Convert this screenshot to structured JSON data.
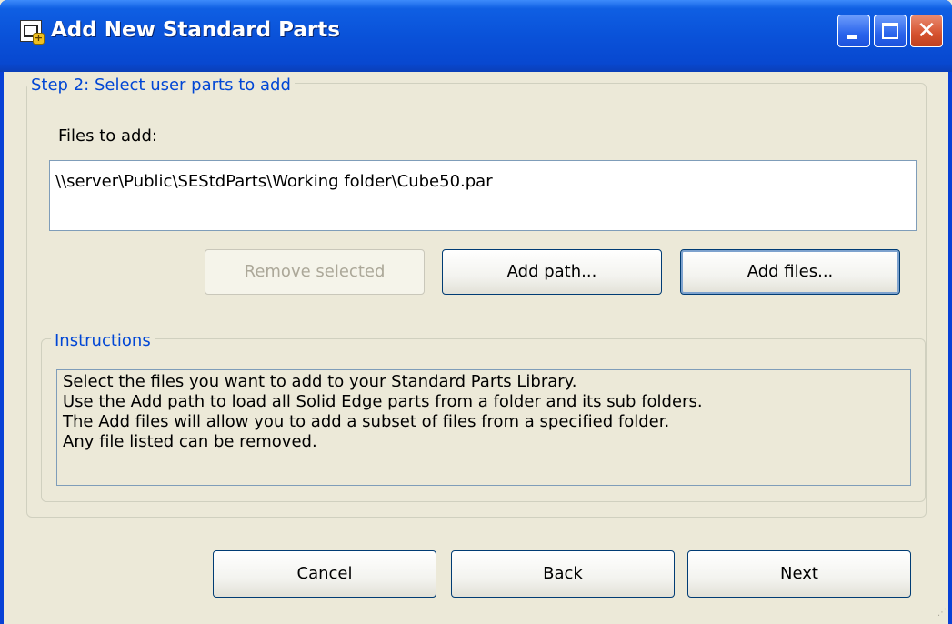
{
  "window": {
    "title": "Add New Standard Parts",
    "icons": {
      "app": "add-part-app-icon",
      "minimize": "minimize-icon",
      "maximize": "maximize-icon",
      "close": "close-icon"
    },
    "close_glyph": "✕"
  },
  "step": {
    "legend": "Step 2: Select user parts to add",
    "files_label": "Files to add:",
    "files": [
      "\\\\server\\Public\\SEStdParts\\Working folder\\Cube50.par"
    ],
    "buttons": {
      "remove": "Remove selected",
      "add_path": "Add path...",
      "add_files": "Add files..."
    }
  },
  "instructions": {
    "legend": "Instructions",
    "lines": [
      "Select the files you want to add to your Standard Parts Library.",
      "Use the Add path to load all Solid Edge parts from a folder and its sub folders.",
      "The Add files will allow you to add a subset of files from a specified folder.",
      "Any file listed can be removed."
    ]
  },
  "footer": {
    "cancel": "Cancel",
    "back": "Back",
    "next": "Next"
  },
  "colors": {
    "titlebar": "#0a52d9",
    "dialog_bg": "#ece9d8",
    "legend_text": "#0046d5",
    "button_border": "#003c74",
    "disabled_text": "#aca899"
  }
}
